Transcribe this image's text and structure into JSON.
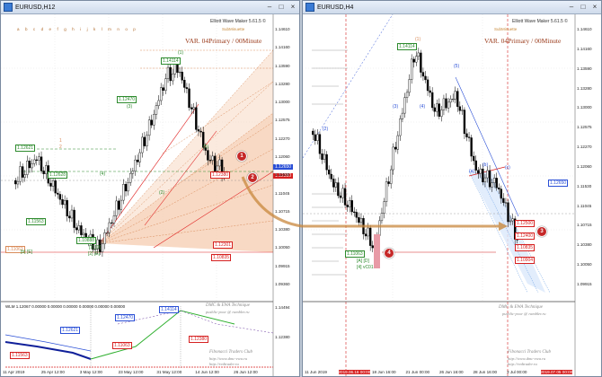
{
  "colors": {
    "up": "#ffffff",
    "down": "#000000",
    "fib": "#d98b5a",
    "blue": "#2a4fd6",
    "green": "#2e8b2e",
    "red": "#d62020",
    "accent": "#c62828"
  },
  "left": {
    "title": "EURUSD,H12",
    "header": "Elliott Wave Maker 5.61.5 ©",
    "var": "VAR. 04Primary / 00Minute",
    "sub": "SubMinuette",
    "letters": "a b c d e f g h i j k l m n o p",
    "price_axis": [
      "1.14610",
      "1.14160",
      "1.13590",
      "1.13280",
      "1.13000",
      "1.12575",
      "1.12270",
      "1.12060",
      "1.11530",
      "1.11045",
      "1.10715",
      "1.10380",
      "1.10050",
      "1.09915",
      "1.09360"
    ],
    "time_axis": [
      "11 Apr 2019",
      "25 Apr 12:00",
      "3 May 12:00",
      "23 May 12:00",
      "31 May 12:00",
      "14 Jun 12:00",
      "26 Jun 12:00"
    ],
    "indicator": "WLM 1.12067 0.00000 0.00000 0.00000 0.00000 0.00000 0.00000",
    "box_labels": [
      "1.14114",
      "1.12470",
      "1.12621",
      "1.12628",
      "1.11563",
      "1.10888",
      "1.12380",
      "1.12301",
      "1.11063",
      "1.10835"
    ],
    "wave_labels": [
      "(1)",
      "(2)",
      "(3)",
      "(4)",
      "(5)",
      "[1] [D]",
      "[2] [E]",
      "[b] [E]",
      "1",
      "2"
    ],
    "markers": [
      "1",
      "2"
    ],
    "price_boxes": [
      "1.12650",
      "1.12380"
    ],
    "sub_axis": [
      "1.14494",
      "1.12380"
    ],
    "bottom_text": [
      "DMC & EWA Technique",
      "pushlic-poor @ rambler.ru",
      "Fibonacci Traders Club",
      "http://www.dmc-ewa.ru",
      "http://redtrader.ru"
    ]
  },
  "right": {
    "title": "EURUSD,H4",
    "header": "Elliott Wave Maker 5.61.5 ©",
    "var": "VAR. 04Primary / 00Minute",
    "sub": "SubMinuette",
    "price_axis": [
      "1.14610",
      "1.14160",
      "1.13590",
      "1.13280",
      "1.13000",
      "1.12575",
      "1.12270",
      "1.12060",
      "1.11530",
      "1.11045",
      "1.10715",
      "1.10380",
      "1.10050",
      "1.09915"
    ],
    "time_axis": [
      "11 Jun 2019",
      "2019.06.16 00:00",
      "18 Jun 16:00",
      "21 Jun 00:00",
      "26 Jun 16:00",
      "28 Jun 16:00",
      "3 Jul 00:00",
      "2019.07.05 00:00"
    ],
    "box_labels": [
      "1.14114",
      "1.12650",
      "1.12500",
      "1.12400",
      "1.11063",
      "1.10835",
      "1.10904"
    ],
    "wave_labels": [
      "(1)",
      "(2)",
      "(3)",
      "(4)",
      "(5)",
      "(a)",
      "(b)",
      "(c)",
      "[A] [D]",
      "[4] vC01"
    ],
    "markers": [
      "3",
      "4"
    ],
    "bottom_text": [
      "DMC & EWA Technique",
      "pushlic-poor @ rambler.ru",
      "Fibonacci Traders Club",
      "http://www.dmc-ewa.ru",
      "http://redtrader.ru"
    ]
  }
}
